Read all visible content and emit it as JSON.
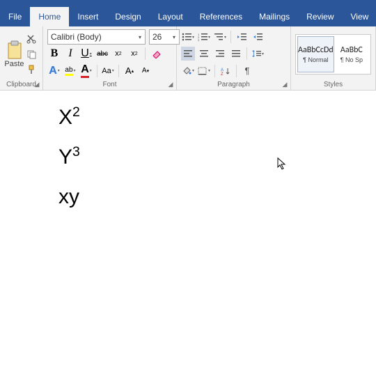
{
  "tabs": [
    "File",
    "Home",
    "Insert",
    "Design",
    "Layout",
    "References",
    "Mailings",
    "Review",
    "View"
  ],
  "active_tab": 1,
  "clipboard": {
    "paste_label": "Paste",
    "group": "Clipboard"
  },
  "font": {
    "name": "Calibri (Body)",
    "size": "26",
    "bold": "B",
    "italic": "I",
    "underline": "U",
    "strike": "abc",
    "sub": "x",
    "sup": "x",
    "group": "Font",
    "grow": "A",
    "shrink": "A",
    "case": "Aa"
  },
  "paragraph": {
    "group": "Paragraph"
  },
  "styles": {
    "group": "Styles",
    "items": [
      {
        "preview": "AaBbCcDd",
        "name": "¶ Normal"
      },
      {
        "preview": "AaBbC",
        "name": "¶ No Sp"
      }
    ]
  },
  "document": {
    "line1_base": "X",
    "line1_sup": "2",
    "line2_base": "Y",
    "line2_sup": "3",
    "line3": "xy"
  }
}
